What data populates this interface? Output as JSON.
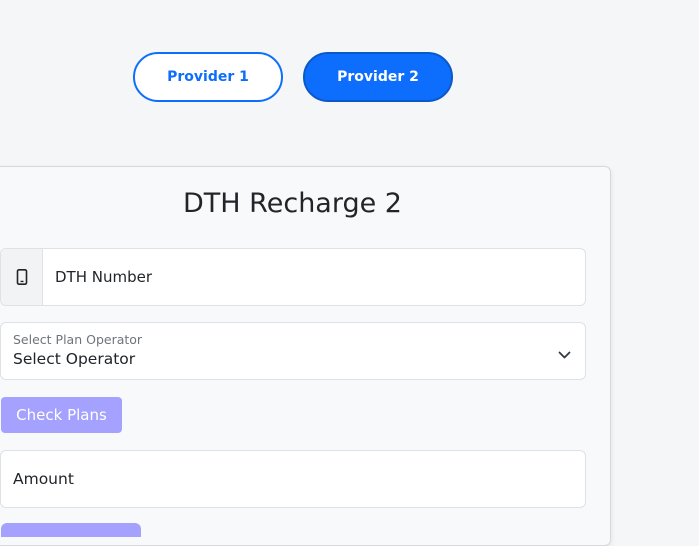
{
  "providers": {
    "provider1_label": "Provider 1",
    "provider2_label": "Provider 2"
  },
  "form": {
    "title": "DTH Recharge 2",
    "dth_number_placeholder": "DTH Number",
    "operator_label": "Select Plan Operator",
    "operator_value": "Select Operator",
    "check_plans_label": "Check Plans",
    "amount_placeholder": "Amount"
  },
  "icons": {
    "phone": "mobile-phone-icon",
    "chevron": "chevron-down-icon"
  },
  "colors": {
    "primary": "#0d6efd",
    "button_light_purple": "#a5a1ff"
  }
}
